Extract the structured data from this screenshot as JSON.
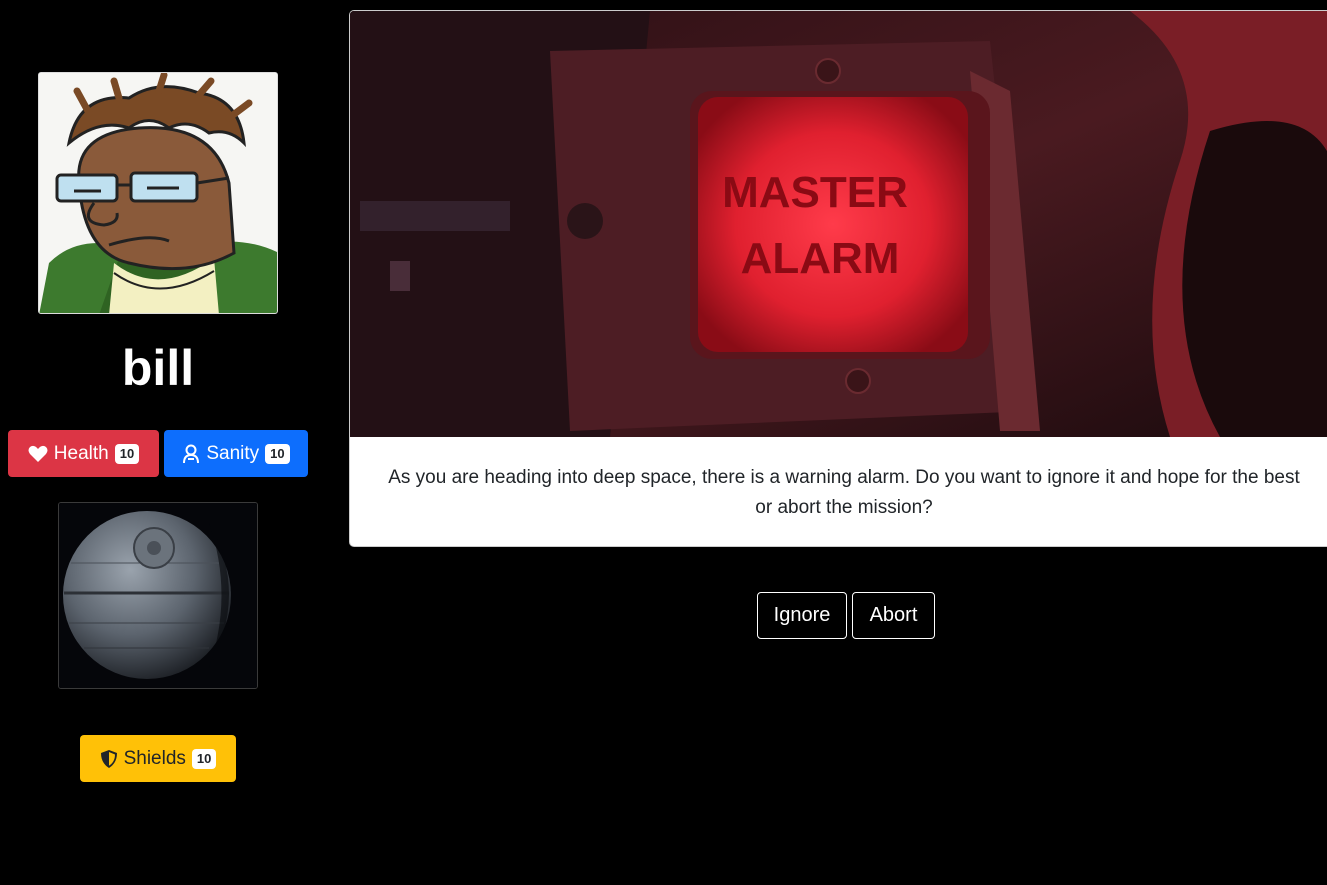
{
  "player": {
    "name": "bill",
    "avatar_icon": "cartoon-character-avatar"
  },
  "stats": {
    "health": {
      "label": "Health",
      "value": "10",
      "icon": "heart-icon",
      "color": "#dc3545"
    },
    "sanity": {
      "label": "Sanity",
      "value": "10",
      "icon": "person-badge-icon",
      "color": "#0d6efd"
    },
    "shields": {
      "label": "Shields",
      "value": "10",
      "icon": "shield-icon",
      "color": "#ffc107"
    }
  },
  "ship": {
    "icon": "death-star-ship"
  },
  "event": {
    "scene_label_line1": "MASTER",
    "scene_label_line2": "ALARM",
    "text": "As you are heading into deep space, there is a warning alarm. Do you want to ignore it and hope for the best or abort the mission?"
  },
  "choices": {
    "ignore": "Ignore",
    "abort": "Abort"
  }
}
